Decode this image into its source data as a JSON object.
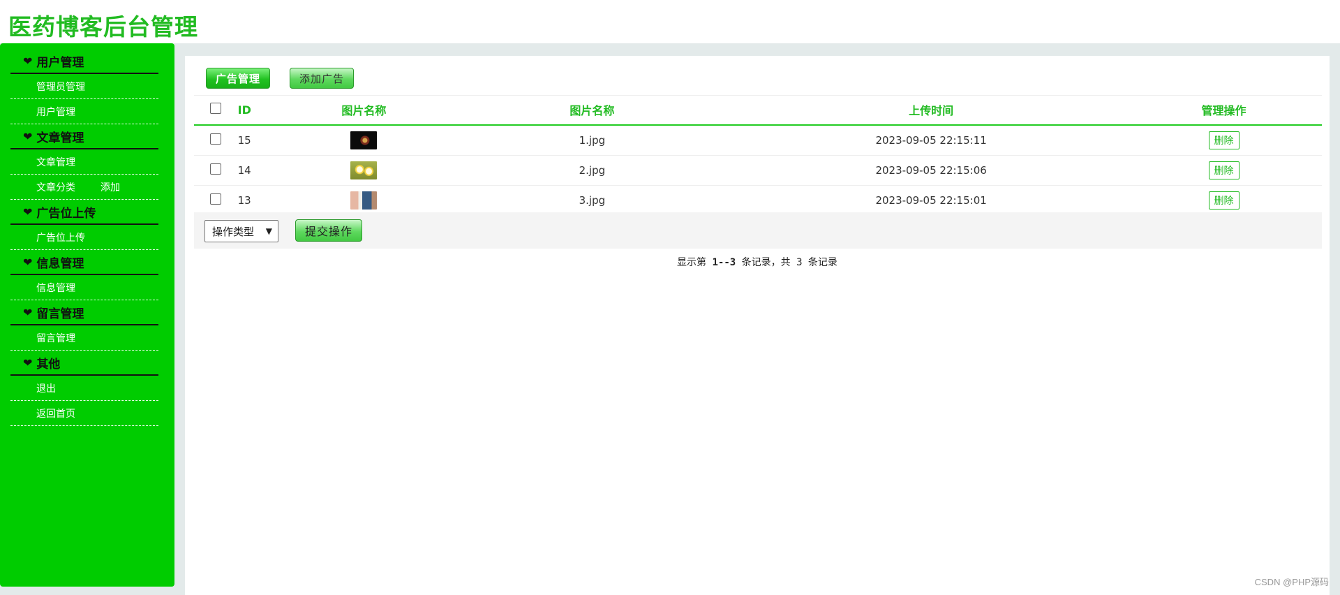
{
  "app": {
    "title": "医药博客后台管理"
  },
  "sidebar": {
    "groups": [
      {
        "title": "用户管理",
        "items": [
          {
            "label": "管理员管理"
          },
          {
            "label": "用户管理"
          }
        ]
      },
      {
        "title": "文章管理",
        "items": [
          {
            "label": "文章管理"
          },
          {
            "label": "文章分类",
            "extra": "添加"
          }
        ]
      },
      {
        "title": "广告位上传",
        "items": [
          {
            "label": "广告位上传"
          }
        ]
      },
      {
        "title": "信息管理",
        "items": [
          {
            "label": "信息管理"
          }
        ]
      },
      {
        "title": "留言管理",
        "items": [
          {
            "label": "留言管理"
          }
        ]
      },
      {
        "title": "其他",
        "items": [
          {
            "label": "退出"
          },
          {
            "label": "返回首页"
          }
        ]
      }
    ]
  },
  "toolbar": {
    "primary_label": "广告管理",
    "secondary_label": "添加广告"
  },
  "table": {
    "headers": {
      "id": "ID",
      "image": "图片名称",
      "name": "图片名称",
      "time": "上传时间",
      "ops": "管理操作"
    },
    "rows": [
      {
        "id": "15",
        "name": "1.jpg",
        "time": "2023-09-05 22:15:11",
        "action": "删除"
      },
      {
        "id": "14",
        "name": "2.jpg",
        "time": "2023-09-05 22:15:06",
        "action": "删除"
      },
      {
        "id": "13",
        "name": "3.jpg",
        "time": "2023-09-05 22:15:01",
        "action": "删除"
      }
    ]
  },
  "footer": {
    "select_value": "操作类型",
    "submit_label": "提交操作",
    "pagination": {
      "prefix": "显示第 ",
      "range": "1--3",
      "middle": " 条记录，共 ",
      "total": "3",
      "suffix": " 条记录"
    }
  },
  "watermark": "CSDN @PHP源码",
  "colors": {
    "brand_green": "#00cc00",
    "accent_green": "#22bb22",
    "shell_bg": "#e3eaea"
  }
}
